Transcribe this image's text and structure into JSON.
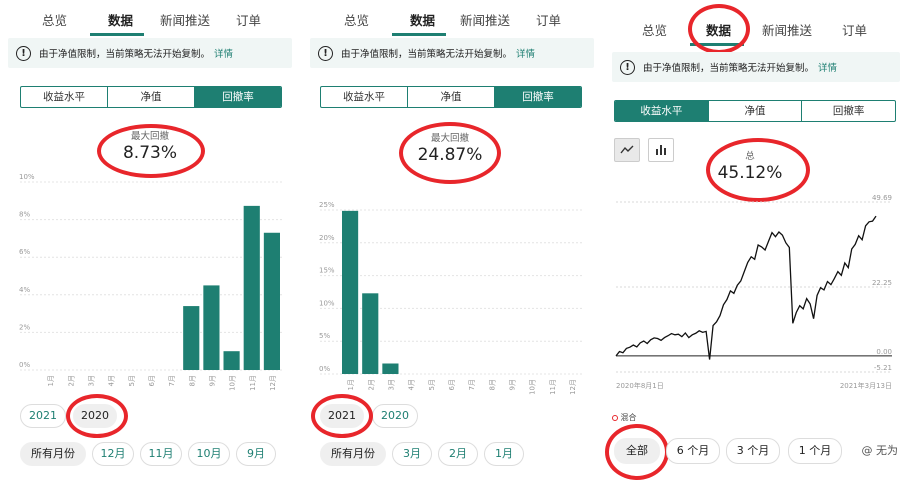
{
  "tabs": [
    "总览",
    "数据",
    "新闻推送",
    "订单"
  ],
  "banner": {
    "text": "由于净值限制，当前策略无法开始复制。",
    "link": "详情",
    "icon": "info-icon"
  },
  "segments": [
    "收益水平",
    "净值",
    "回撤率"
  ],
  "accent_color": "#1e7f72",
  "highlight_color": "#e8262b",
  "panel1": {
    "metric_label": "最大回撤",
    "metric_value": "8.73%",
    "years": [
      "2021",
      "2020"
    ],
    "selected_year": "2020",
    "months": [
      "所有月份",
      "12月",
      "11月",
      "10月",
      "9月"
    ]
  },
  "panel2": {
    "metric_label": "最大回撤",
    "metric_value": "24.87%",
    "years": [
      "2021",
      "2020"
    ],
    "selected_year": "2021",
    "months": [
      "所有月份",
      "3月",
      "2月",
      "1月"
    ]
  },
  "panel3": {
    "metric_label": "总",
    "metric_value": "45.12%",
    "chart_icons": [
      "line-chart-icon",
      "bar-chart-icon"
    ],
    "legend_label": "混合",
    "x_start": "2020年8月1日",
    "x_end": "2021年3月13日",
    "periods": [
      "全部",
      "6 个月",
      "3 个月",
      "1 个月"
    ]
  },
  "watermark": "@ 无为",
  "chart_data": [
    {
      "type": "bar",
      "title": "",
      "categories": [
        "1月",
        "2月",
        "3月",
        "4月",
        "5月",
        "6月",
        "7月",
        "8月",
        "9月",
        "10月",
        "11月",
        "12月"
      ],
      "values": [
        0,
        0,
        0,
        0,
        0,
        0,
        0,
        3.4,
        4.5,
        1.0,
        8.73,
        7.3
      ],
      "yticks": [
        "0%",
        "2%",
        "4%",
        "6%",
        "8%",
        "10%"
      ],
      "ylim": [
        0,
        10
      ],
      "grid": true
    },
    {
      "type": "bar",
      "title": "",
      "categories": [
        "1月",
        "2月",
        "3月",
        "4月",
        "5月",
        "6月",
        "7月",
        "8月",
        "9月",
        "10月",
        "11月",
        "12月"
      ],
      "values": [
        24.87,
        12.3,
        1.6,
        0,
        0,
        0,
        0,
        0,
        0,
        0,
        0,
        0
      ],
      "yticks": [
        "0%",
        "5%",
        "10%",
        "15%",
        "20%",
        "25%"
      ],
      "ylim": [
        0,
        25
      ],
      "grid": true
    },
    {
      "type": "line",
      "title": "",
      "x": [
        "2020年8月1日",
        "2021年3月13日"
      ],
      "ytick_labels": [
        "49.69",
        "22.25",
        "0.00",
        "-5.21"
      ],
      "ylim": [
        -5.21,
        49.69
      ],
      "values": [
        0,
        1.4,
        1.0,
        2.4,
        2.8,
        3.5,
        2.9,
        4.2,
        4.8,
        4.0,
        5.2,
        5.8,
        5.6,
        5.0,
        5.9,
        6.5,
        7.2,
        6.8,
        7.0,
        6.2,
        7.4,
        5.9,
        6.8,
        7.3,
        8.1,
        7.6,
        7.9,
        -1.2,
        9.8,
        11.0,
        13.0,
        16.5,
        18.2,
        21.0,
        20.2,
        22.8,
        24.2,
        27.2,
        30.2,
        32.0,
        31.2,
        35.8,
        35.2,
        34.2,
        37.0,
        39.8,
        38.5,
        40.0,
        39.0,
        36.5,
        35.0,
        10.5,
        14.0,
        16.2,
        15.2,
        18.5,
        16.8,
        12.0,
        19.5,
        22.0,
        21.3,
        24.0,
        23.0,
        25.0,
        27.2,
        26.0,
        30.0,
        28.5,
        34.5,
        36.0,
        38.8,
        37.5,
        42.0,
        43.3,
        43.5,
        45.12
      ],
      "grid": true
    }
  ]
}
